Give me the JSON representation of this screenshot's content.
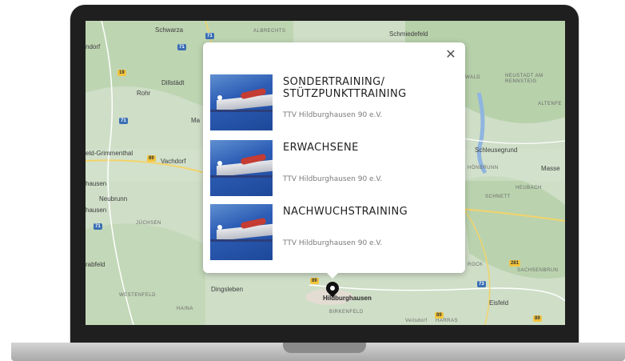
{
  "map": {
    "places": [
      "Schwarza",
      "ALBRECHTS",
      "Schmiedefeld",
      "ndorf",
      "Dillstädt",
      "Rohr",
      "Ma",
      "eld-Grimmenthal",
      "Vachdorf",
      "hausen",
      "Neubrunn",
      "hausen",
      "JÜCHSEN",
      "rabfeld",
      "WESTENFELD",
      "HAINA",
      "Dingsleben",
      "Hildburghausen",
      "BIRKENFELD",
      "WALD",
      "NEUSTADT AM RENNSTEIG",
      "ALTENFE",
      "Schleusegrund",
      "HÖNBRUNN",
      "Masse",
      "HEUBACH",
      "SCHNETT",
      "ROCK",
      "SACHSENBRUN",
      "Eisfeld",
      "Veilsdorf",
      "HARRAS"
    ],
    "road_shields": [
      "71",
      "71",
      "19",
      "71",
      "89",
      "71",
      "89",
      "281",
      "73",
      "89",
      "89"
    ],
    "accent_water": "#7ea8d8",
    "map_background": "#ccdcc4"
  },
  "popup": {
    "close_symbol": "✕",
    "events": [
      {
        "title": "SONDERTRAINING/ STÜTZPUNKTTRAINING",
        "club": "TTV Hildburghausen 90 e.V."
      },
      {
        "title": "ERWACHSENE",
        "club": "TTV Hildburghausen 90 e.V."
      },
      {
        "title": "NACHWUCHSTRAINING",
        "club": "TTV Hildburghausen 90 e.V."
      }
    ]
  },
  "marker": {
    "icon": "map-pin-icon"
  }
}
